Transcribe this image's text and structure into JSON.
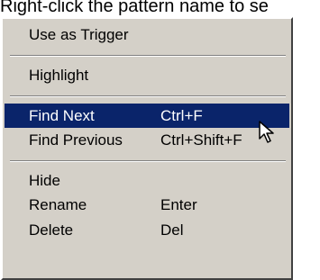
{
  "caption": "Right-click the pattern name to se",
  "menu": {
    "items": [
      {
        "label": "Use as Trigger",
        "shortcut": ""
      },
      {
        "label": "Highlight",
        "shortcut": ""
      },
      {
        "label": "Find Next",
        "shortcut": "Ctrl+F"
      },
      {
        "label": "Find Previous",
        "shortcut": "Ctrl+Shift+F"
      },
      {
        "label": "Hide",
        "shortcut": ""
      },
      {
        "label": "Rename",
        "shortcut": "Enter"
      },
      {
        "label": "Delete",
        "shortcut": "Del"
      }
    ],
    "selected_label": "Find Next"
  },
  "colors": {
    "menu_bg": "#d4d0c8",
    "highlight_bg": "#0a246a",
    "highlight_text": "#ffffff"
  },
  "icons": {
    "cursor": "arrow-pointer-icon"
  }
}
